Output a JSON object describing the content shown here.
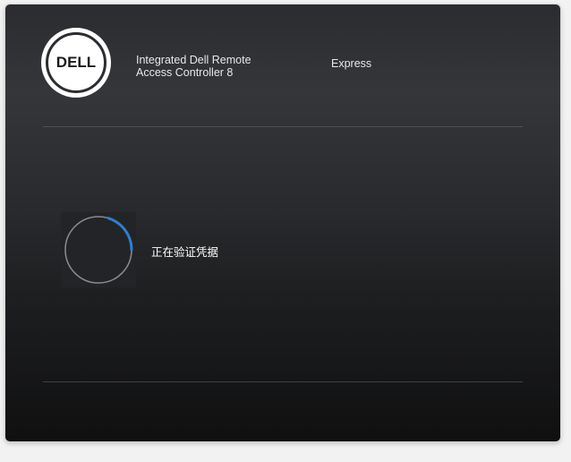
{
  "header": {
    "logo_text": "DELL",
    "product_line1": "Integrated Dell Remote",
    "product_line2": "Access Controller 8",
    "edition": "Express"
  },
  "main": {
    "status_text": "正在验证凭据"
  },
  "colors": {
    "spinner_accent": "#2f7fd0",
    "spinner_track": "#8a8c90"
  }
}
